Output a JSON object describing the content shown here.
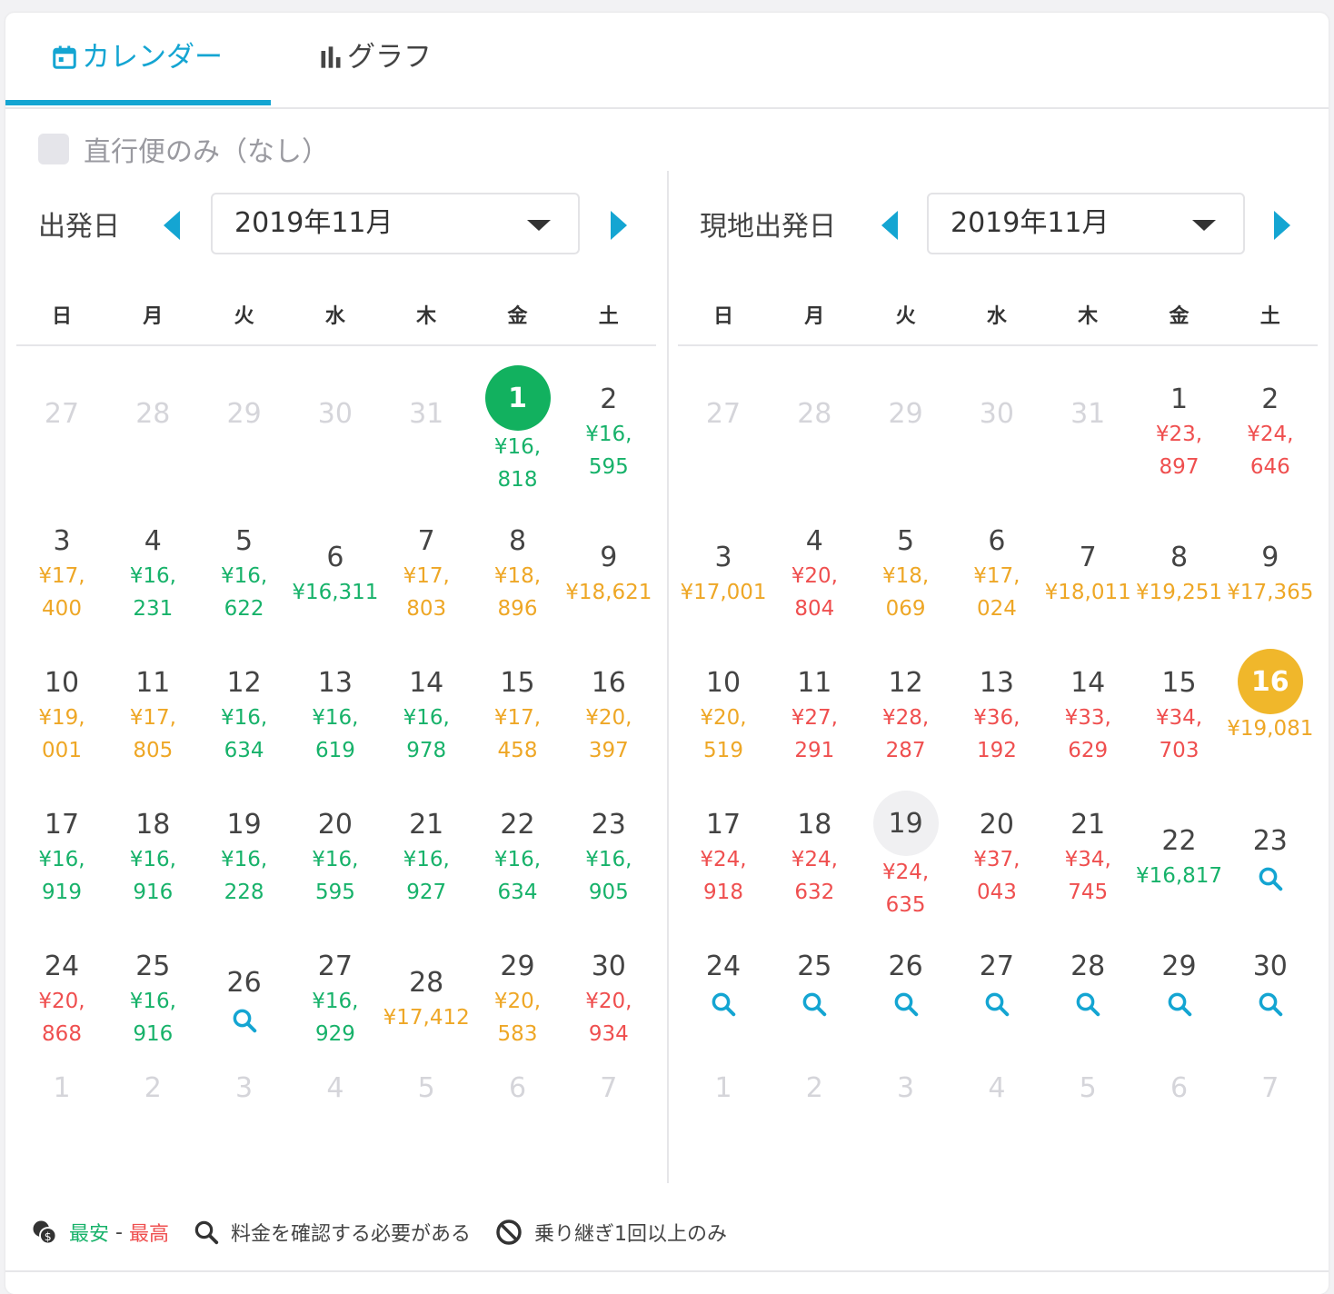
{
  "tabs": {
    "calendar": "カレンダー",
    "graph": "グラフ"
  },
  "filter": {
    "direct_only": "直行便のみ（なし）"
  },
  "colors": {
    "accent": "#14a5d2",
    "cheap": "#17b26a",
    "mid": "#eea726",
    "high": "#ef4f4f"
  },
  "weekdays": [
    "日",
    "月",
    "火",
    "水",
    "木",
    "金",
    "土"
  ],
  "left": {
    "label": "出発日",
    "month": "2019年11月",
    "cells": [
      {
        "d": "27",
        "o": true
      },
      {
        "d": "28",
        "o": true
      },
      {
        "d": "29",
        "o": true
      },
      {
        "d": "30",
        "o": true
      },
      {
        "d": "31",
        "o": true
      },
      {
        "d": "1",
        "p1": "¥16,",
        "p2": "818",
        "c": "g",
        "sel": "green"
      },
      {
        "d": "2",
        "p1": "¥16,",
        "p2": "595",
        "c": "g"
      },
      {
        "d": "3",
        "p1": "¥17,",
        "p2": "400",
        "c": "y"
      },
      {
        "d": "4",
        "p1": "¥16,",
        "p2": "231",
        "c": "g"
      },
      {
        "d": "5",
        "p1": "¥16,",
        "p2": "622",
        "c": "g"
      },
      {
        "d": "6",
        "p1": "¥16,311",
        "c": "g"
      },
      {
        "d": "7",
        "p1": "¥17,",
        "p2": "803",
        "c": "y"
      },
      {
        "d": "8",
        "p1": "¥18,",
        "p2": "896",
        "c": "y"
      },
      {
        "d": "9",
        "p1": "¥18,621",
        "c": "y"
      },
      {
        "d": "10",
        "p1": "¥19,",
        "p2": "001",
        "c": "y"
      },
      {
        "d": "11",
        "p1": "¥17,",
        "p2": "805",
        "c": "y"
      },
      {
        "d": "12",
        "p1": "¥16,",
        "p2": "634",
        "c": "g"
      },
      {
        "d": "13",
        "p1": "¥16,",
        "p2": "619",
        "c": "g"
      },
      {
        "d": "14",
        "p1": "¥16,",
        "p2": "978",
        "c": "g"
      },
      {
        "d": "15",
        "p1": "¥17,",
        "p2": "458",
        "c": "y"
      },
      {
        "d": "16",
        "p1": "¥20,",
        "p2": "397",
        "c": "y"
      },
      {
        "d": "17",
        "p1": "¥16,",
        "p2": "919",
        "c": "g"
      },
      {
        "d": "18",
        "p1": "¥16,",
        "p2": "916",
        "c": "g"
      },
      {
        "d": "19",
        "p1": "¥16,",
        "p2": "228",
        "c": "g"
      },
      {
        "d": "20",
        "p1": "¥16,",
        "p2": "595",
        "c": "g"
      },
      {
        "d": "21",
        "p1": "¥16,",
        "p2": "927",
        "c": "g"
      },
      {
        "d": "22",
        "p1": "¥16,",
        "p2": "634",
        "c": "g"
      },
      {
        "d": "23",
        "p1": "¥16,",
        "p2": "905",
        "c": "g"
      },
      {
        "d": "24",
        "p1": "¥20,",
        "p2": "868",
        "c": "r"
      },
      {
        "d": "25",
        "p1": "¥16,",
        "p2": "916",
        "c": "g"
      },
      {
        "d": "26",
        "search": true
      },
      {
        "d": "27",
        "p1": "¥16,",
        "p2": "929",
        "c": "g"
      },
      {
        "d": "28",
        "p1": "¥17,412",
        "c": "y"
      },
      {
        "d": "29",
        "p1": "¥20,",
        "p2": "583",
        "c": "y"
      },
      {
        "d": "30",
        "p1": "¥20,",
        "p2": "934",
        "c": "r"
      },
      {
        "d": "1",
        "o": true
      },
      {
        "d": "2",
        "o": true
      },
      {
        "d": "3",
        "o": true
      },
      {
        "d": "4",
        "o": true
      },
      {
        "d": "5",
        "o": true
      },
      {
        "d": "6",
        "o": true
      },
      {
        "d": "7",
        "o": true
      }
    ]
  },
  "right": {
    "label": "現地出発日",
    "month": "2019年11月",
    "cells": [
      {
        "d": "27",
        "o": true
      },
      {
        "d": "28",
        "o": true
      },
      {
        "d": "29",
        "o": true
      },
      {
        "d": "30",
        "o": true
      },
      {
        "d": "31",
        "o": true
      },
      {
        "d": "1",
        "p1": "¥23,",
        "p2": "897",
        "c": "r"
      },
      {
        "d": "2",
        "p1": "¥24,",
        "p2": "646",
        "c": "r"
      },
      {
        "d": "3",
        "p1": "¥17,001",
        "c": "y"
      },
      {
        "d": "4",
        "p1": "¥20,",
        "p2": "804",
        "c": "r"
      },
      {
        "d": "5",
        "p1": "¥18,",
        "p2": "069",
        "c": "y"
      },
      {
        "d": "6",
        "p1": "¥17,",
        "p2": "024",
        "c": "y"
      },
      {
        "d": "7",
        "p1": "¥18,011",
        "c": "y"
      },
      {
        "d": "8",
        "p1": "¥19,251",
        "c": "y"
      },
      {
        "d": "9",
        "p1": "¥17,365",
        "c": "y"
      },
      {
        "d": "10",
        "p1": "¥20,",
        "p2": "519",
        "c": "y"
      },
      {
        "d": "11",
        "p1": "¥27,",
        "p2": "291",
        "c": "r"
      },
      {
        "d": "12",
        "p1": "¥28,",
        "p2": "287",
        "c": "r"
      },
      {
        "d": "13",
        "p1": "¥36,",
        "p2": "192",
        "c": "r"
      },
      {
        "d": "14",
        "p1": "¥33,",
        "p2": "629",
        "c": "r"
      },
      {
        "d": "15",
        "p1": "¥34,",
        "p2": "703",
        "c": "r"
      },
      {
        "d": "16",
        "p1": "¥19,081",
        "c": "y",
        "sel": "yellow"
      },
      {
        "d": "17",
        "p1": "¥24,",
        "p2": "918",
        "c": "r"
      },
      {
        "d": "18",
        "p1": "¥24,",
        "p2": "632",
        "c": "r"
      },
      {
        "d": "19",
        "p1": "¥24,",
        "p2": "635",
        "c": "r",
        "sel": "gray"
      },
      {
        "d": "20",
        "p1": "¥37,",
        "p2": "043",
        "c": "r"
      },
      {
        "d": "21",
        "p1": "¥34,",
        "p2": "745",
        "c": "r"
      },
      {
        "d": "22",
        "p1": "¥16,817",
        "c": "g"
      },
      {
        "d": "23",
        "search": true
      },
      {
        "d": "24",
        "search": true
      },
      {
        "d": "25",
        "search": true
      },
      {
        "d": "26",
        "search": true
      },
      {
        "d": "27",
        "search": true
      },
      {
        "d": "28",
        "search": true
      },
      {
        "d": "29",
        "search": true
      },
      {
        "d": "30",
        "search": true
      },
      {
        "d": "1",
        "o": true
      },
      {
        "d": "2",
        "o": true
      },
      {
        "d": "3",
        "o": true
      },
      {
        "d": "4",
        "o": true
      },
      {
        "d": "5",
        "o": true
      },
      {
        "d": "6",
        "o": true
      },
      {
        "d": "7",
        "o": true
      }
    ]
  },
  "legend": {
    "cheapest": "最安",
    "sep": " - ",
    "highest": "最高",
    "check_price": "料金を確認する必要がある",
    "transfer_only": "乗り継ぎ1回以上のみ"
  }
}
